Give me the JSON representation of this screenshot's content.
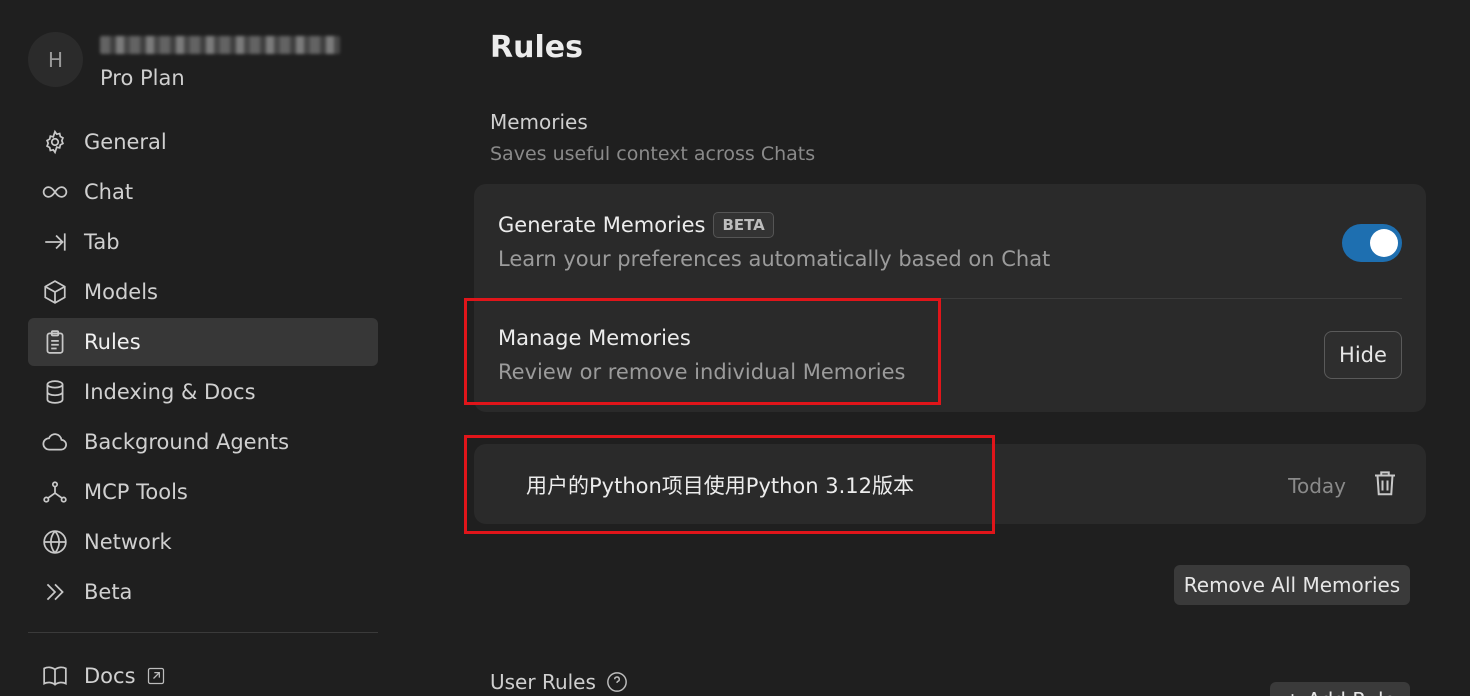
{
  "profile": {
    "avatar_initial": "H",
    "plan": "Pro Plan"
  },
  "sidebar": {
    "items": [
      {
        "label": "General",
        "icon": "gear-icon"
      },
      {
        "label": "Chat",
        "icon": "infinity-icon"
      },
      {
        "label": "Tab",
        "icon": "arrow-right-bar-icon"
      },
      {
        "label": "Models",
        "icon": "cube-icon"
      },
      {
        "label": "Rules",
        "icon": "clipboard-icon",
        "active": true
      },
      {
        "label": "Indexing & Docs",
        "icon": "database-icon"
      },
      {
        "label": "Background Agents",
        "icon": "cloud-icon"
      },
      {
        "label": "MCP Tools",
        "icon": "nodes-icon"
      },
      {
        "label": "Network",
        "icon": "globe-icon"
      },
      {
        "label": "Beta",
        "icon": "double-chevron-icon"
      }
    ],
    "docs_label": "Docs"
  },
  "main": {
    "title": "Rules",
    "memories_label": "Memories",
    "memories_desc": "Saves useful context across Chats",
    "generate": {
      "title": "Generate Memories",
      "badge": "BETA",
      "desc": "Learn your preferences automatically based on Chat",
      "enabled": true
    },
    "manage": {
      "title": "Manage Memories",
      "desc": "Review or remove individual Memories",
      "button": "Hide"
    },
    "memory_item": {
      "text": "用户的Python项目使用Python 3.12版本",
      "date": "Today"
    },
    "remove_all": "Remove All Memories",
    "user_rules_label": "User Rules",
    "add_rule": "+ Add Rule"
  },
  "colors": {
    "accent": "#1e6fb0",
    "highlight": "#e0151a",
    "background": "#1f1f1f",
    "card": "#2a2a2a"
  }
}
